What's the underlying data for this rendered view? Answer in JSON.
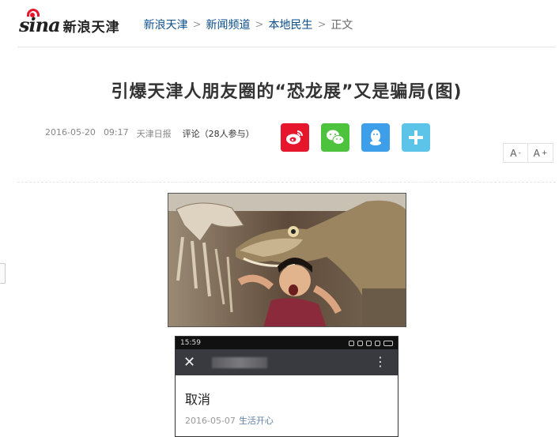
{
  "logo": {
    "brand": "sina",
    "text": "新浪天津"
  },
  "breadcrumb": {
    "items": [
      "新浪天津",
      "新闻频道",
      "本地民生"
    ],
    "current": "正文",
    "separator": ">"
  },
  "article": {
    "title": "引爆天津人朋友圈的“恐龙展”又是骗局(图)",
    "date": "2016-05-20",
    "time": "09:17",
    "source": "天津日报",
    "comment_label": "评论",
    "comment_count": "（28人参与）"
  },
  "share": {
    "icons": [
      "weibo-icon",
      "wechat-icon",
      "qq-icon",
      "plus-icon"
    ],
    "colors": {
      "weibo": "#e6162d",
      "wechat": "#4cc23d",
      "qq": "#3d9ee9",
      "more": "#5bc4e8"
    }
  },
  "font_controls": {
    "smaller": "A",
    "smaller_sign": "-",
    "larger": "A",
    "larger_sign": "+"
  },
  "phone": {
    "time": "15:59",
    "post_title": "取消",
    "post_date": "2016-05-07",
    "post_account": "生活开心"
  }
}
